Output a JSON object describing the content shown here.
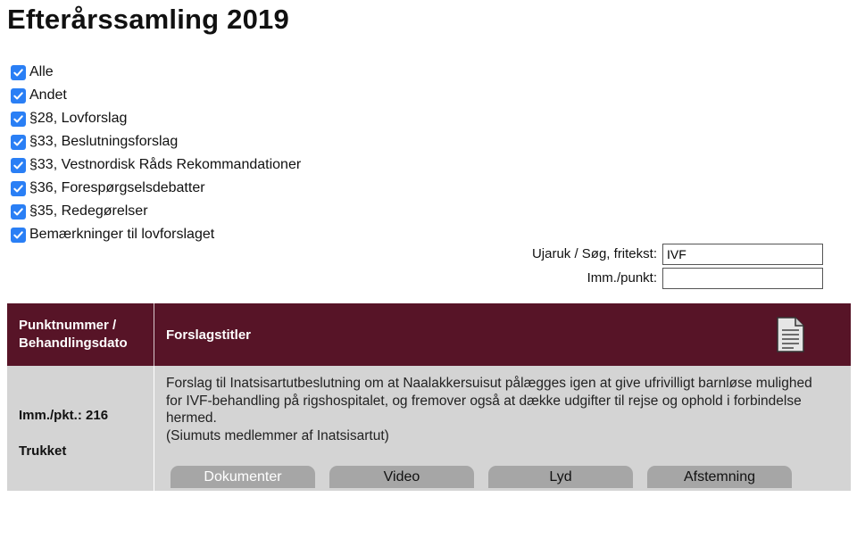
{
  "page": {
    "title": "Efterårssamling 2019"
  },
  "filters": [
    {
      "label": "Alle",
      "checked": true
    },
    {
      "label": "Andet",
      "checked": true
    },
    {
      "label": "§28, Lovforslag",
      "checked": true
    },
    {
      "label": "§33, Beslutningsforslag",
      "checked": true
    },
    {
      "label": "§33, Vestnordisk Råds Rekommandationer",
      "checked": true
    },
    {
      "label": "§36, Forespørgselsdebatter",
      "checked": true
    },
    {
      "label": "§35, Redegørelser",
      "checked": true
    },
    {
      "label": "Bemærkninger til lovforslaget",
      "checked": true
    }
  ],
  "search": {
    "freetext_label": "Ujaruk / Søg, fritekst:",
    "freetext_value": "IVF",
    "item_label": "Imm./punkt:",
    "item_value": ""
  },
  "table": {
    "col1_header_line1": "Punktnummer /",
    "col1_header_line2": "Behandlingsdato",
    "col2_header": "Forslagstitler",
    "header_icon": "document-icon",
    "rows": [
      {
        "item": "Imm./pkt.: 216",
        "status": "Trukket",
        "title": "Forslag til Inatsisartutbeslutning om at Naalakkersuisut pålægges igen at give ufrivilligt barnløse mulighed for IVF-behandling på rigshospitalet, og fremover også at dække udgifter til rejse og ophold i forbindelse hermed.",
        "proposer": "(Siumuts medlemmer af Inatsisartut)",
        "tabs": [
          "Dokumenter",
          "Video",
          "Lyd",
          "Afstemning"
        ]
      }
    ]
  },
  "colors": {
    "header_bg": "#571427",
    "row_bg": "#d4d4d4",
    "tab_bg": "#a6a6a6",
    "checkbox": "#2a7ff5"
  }
}
